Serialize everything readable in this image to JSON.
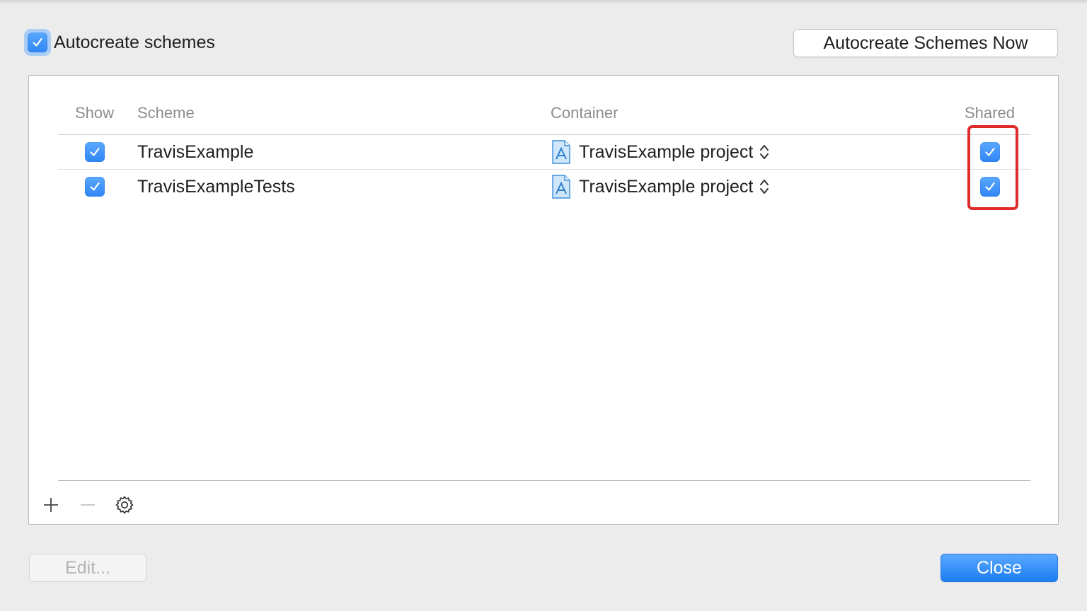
{
  "autocreate": {
    "label": "Autocreate schemes",
    "checked": true
  },
  "buttons": {
    "autocreate_now": "Autocreate Schemes Now",
    "edit": "Edit...",
    "close": "Close"
  },
  "table": {
    "headers": {
      "show": "Show",
      "scheme": "Scheme",
      "container": "Container",
      "shared": "Shared"
    },
    "rows": [
      {
        "show": true,
        "scheme": "TravisExample",
        "container": "TravisExample project",
        "shared": true
      },
      {
        "show": true,
        "scheme": "TravisExampleTests",
        "container": "TravisExample project",
        "shared": true
      }
    ]
  },
  "icons": {
    "checkbox": "checkmark-icon",
    "container": "xcode-project-file-icon",
    "stepper": "up-down-chevron-icon",
    "add": "plus-icon",
    "remove": "minus-icon",
    "action": "gear-icon"
  },
  "colors": {
    "accent": "#2f86f5",
    "highlight": "#e02b2b",
    "close_button": "#1d7df2"
  }
}
